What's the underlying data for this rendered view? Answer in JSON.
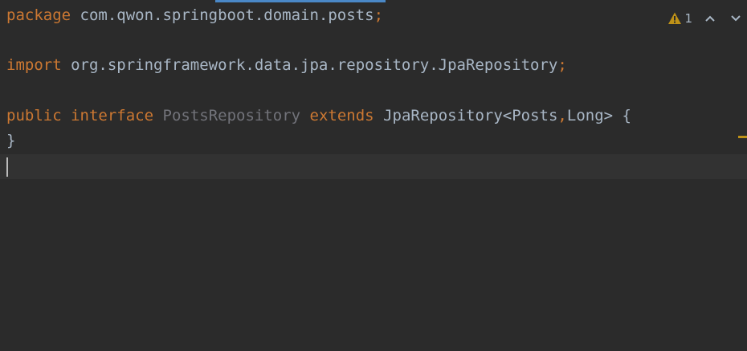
{
  "editor": {
    "lines": {
      "package_kw": "package",
      "package_name": " com.qwon.springboot.domain.posts",
      "package_semi": ";",
      "import_kw": "import",
      "import_name": " org.springframework.data.jpa.repository.JpaRepository",
      "import_semi": ";",
      "public_kw": "public",
      "interface_kw": "interface",
      "type_name": "PostsRepository",
      "extends_kw": "extends",
      "super_type": "JpaRepository<Posts",
      "comma": ",",
      "super_type_rest": "Long> {",
      "closing_brace": "}"
    }
  },
  "inspection": {
    "warning_count": "1",
    "warning_icon": "warning-triangle-icon",
    "prev_icon": "chevron-up-icon",
    "next_icon": "chevron-down-icon"
  },
  "colors": {
    "background": "#2b2b2b",
    "keyword": "#cc7832",
    "text": "#a9b7c6",
    "unused": "#72737a",
    "warning": "#be9117",
    "tab_indicator": "#4a88c7"
  }
}
